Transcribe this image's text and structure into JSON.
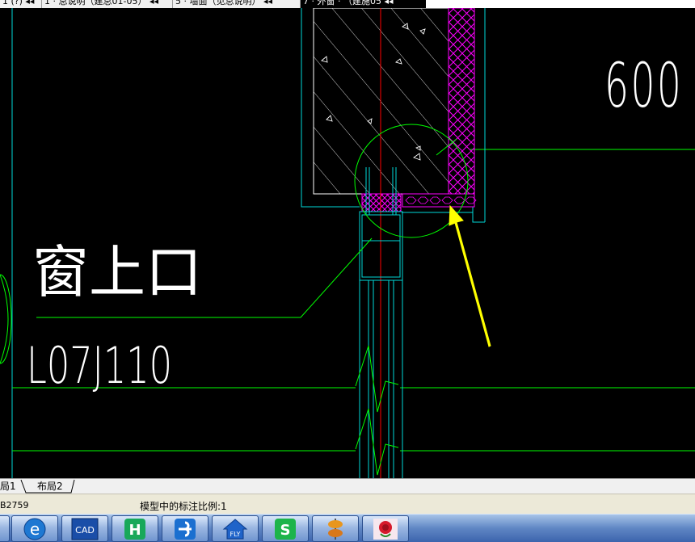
{
  "document_tabs": [
    {
      "label": "1 (?) ◂◂",
      "active": false
    },
    {
      "label": "1 · 总说明（建总01-05） ◂◂",
      "active": false
    },
    {
      "label": "5 · 墙面（见总说明） ◂◂",
      "active": false
    },
    {
      "label": "7 · 外窗 · （建施05 ◂◂",
      "active": true
    }
  ],
  "drawing": {
    "dimension_text": "600",
    "callout_label": "窗上口",
    "reference_code": "L07J110"
  },
  "layout_tabs": [
    "局1",
    "布局2"
  ],
  "status": {
    "coordinates": "B2759",
    "annotation_scale": "模型中的标注比例:1"
  },
  "taskbar": {
    "apps": [
      {
        "icon": "browser-icon",
        "label": "e"
      },
      {
        "icon": "cad-icon",
        "label": "CAD"
      },
      {
        "icon": "h-app-icon",
        "label": "H"
      },
      {
        "icon": "pinwheel-icon",
        "label": ""
      },
      {
        "icon": "fly-icon",
        "label": "FLY"
      },
      {
        "icon": "s-app-icon",
        "label": "S"
      },
      {
        "icon": "stack-icon",
        "label": ""
      },
      {
        "icon": "rose-icon",
        "label": ""
      }
    ]
  },
  "colors": {
    "background": "#000000",
    "wall_outline": "#00d7d7",
    "leader_lines": "#00ff00",
    "insulation": "#ff00ff",
    "axis_line": "#ff0000",
    "arrow": "#ffff00",
    "text": "#ffffff"
  }
}
